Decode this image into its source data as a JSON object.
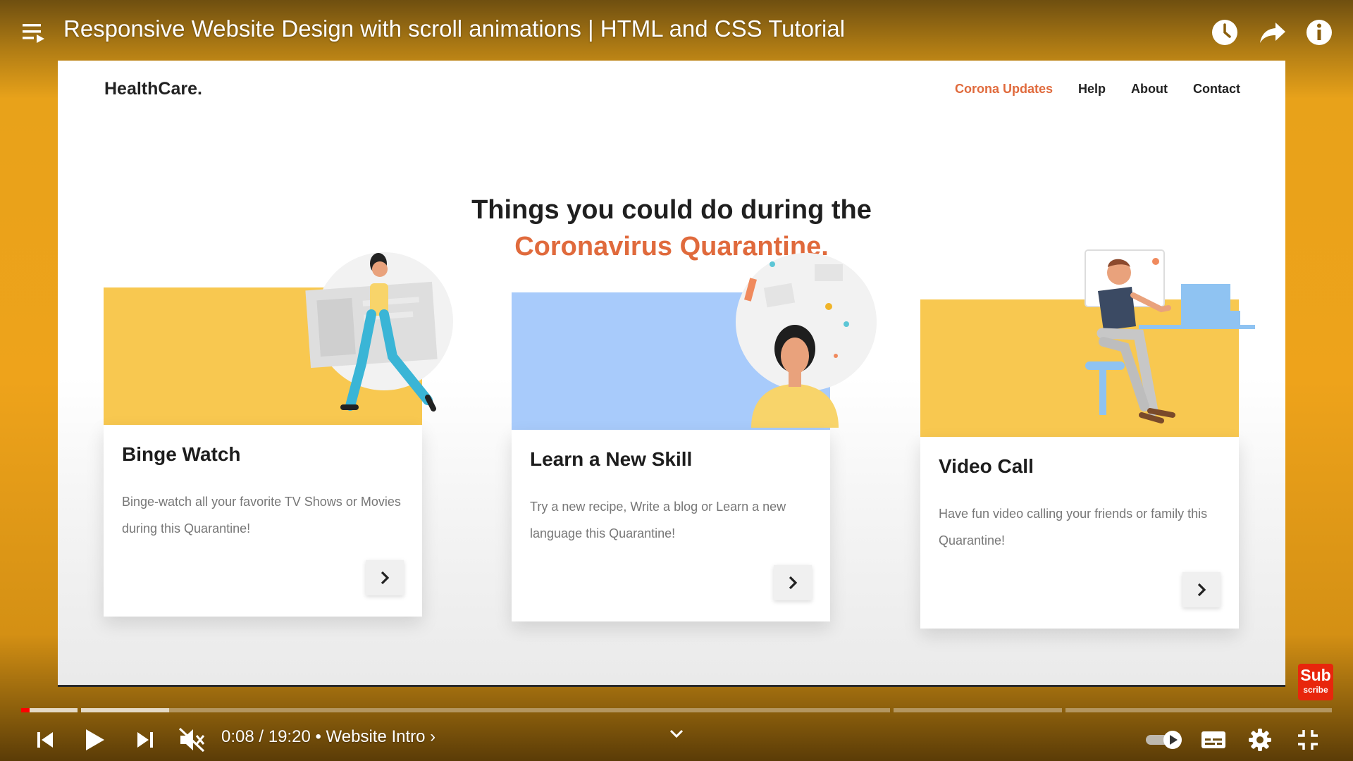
{
  "player": {
    "title": "Responsive Website Design with scroll animations | HTML and CSS Tutorial",
    "time_current": "0:08",
    "time_separator": "/",
    "time_total": "19:20",
    "chapter_separator": "•",
    "chapter": "Website Intro",
    "chapter_chevron": "›",
    "progress_played_fraction": 0.0067,
    "icons": [
      "playlist-icon",
      "watch-later-icon",
      "share-icon",
      "info-icon",
      "previous-icon",
      "play-icon",
      "next-icon",
      "mute-icon",
      "chevron-down-icon",
      "autoplay-toggle-icon",
      "subtitles-icon",
      "settings-icon",
      "exit-fullscreen-icon"
    ],
    "subscribe": {
      "top": "Sub",
      "bottom": "scribe"
    }
  },
  "site": {
    "brand": "HealthCare.",
    "nav": [
      "Corona Updates",
      "Help",
      "About",
      "Contact"
    ],
    "headline_line1": "Things you could do during the",
    "headline_line2": "Coronavirus Quarantine.",
    "cards": [
      {
        "title": "Binge Watch",
        "description": "Binge-watch all your favorite TV Shows or Movies during this Quarantine!"
      },
      {
        "title": "Learn a New Skill",
        "description": "Try a new recipe, Write a blog or Learn a new language this Quarantine!"
      },
      {
        "title": "Video Call",
        "description": "Have fun video calling your friends or family this Quarantine!"
      }
    ]
  },
  "colors": {
    "accent": "#e06a3c",
    "card_yellow": "#f8c850",
    "card_blue": "#a8cbfb",
    "player_red": "#ff0000",
    "background_amber": "#eea31b"
  }
}
